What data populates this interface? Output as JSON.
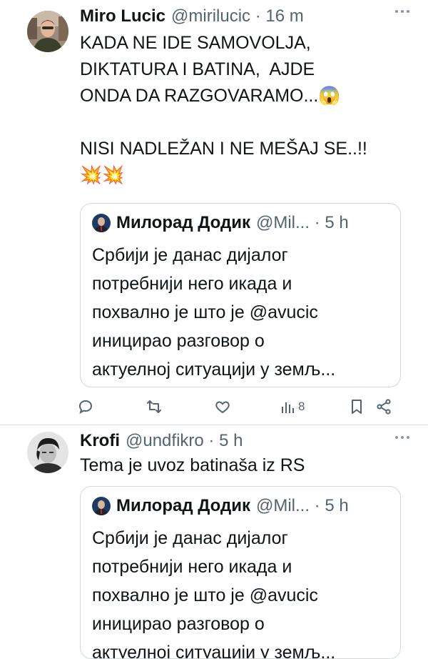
{
  "colors": {
    "text": "#0f1419",
    "secondary": "#536471",
    "border": "#cfd9de",
    "separator": "#d7dbdf"
  },
  "tweets": [
    {
      "author": "Miro Lucic",
      "handle": "@mirilucic · 16 m",
      "text": "KADA NE IDE SAMOVOLJA,\nDIKTATURA I BATINA,  AJDE\nONDA DA RAZGOVARAMO...😱\n\nNISI NADLEŽAN I NE MEŠAJ SE..!!\n💥💥",
      "quote": {
        "author": "Милорад Додик",
        "handle": "@Mil... · 5 h",
        "text": "Србији је данас дијалог\nпотребнији него икада и\nпохвално је што је @avucic\nиницирао разговор о\nактуелној ситуацији у земљ..."
      },
      "actions": {
        "reply_icon": "reply-icon",
        "retweet_icon": "retweet-icon",
        "like_icon": "like-icon",
        "views_icon": "views-icon",
        "views_count": "8",
        "bookmark_icon": "bookmark-icon",
        "share_icon": "share-icon"
      }
    },
    {
      "author": "Krofi",
      "handle": "@undfikro · 5 h",
      "text": "Tema je uvoz batinaša iz RS",
      "quote": {
        "author": "Милорад Додик",
        "handle": "@Mil... · 5 h",
        "text": "Србији је данас дијалог\nпотребнији него икада и\nпохвално је што је @avucic\nиницирао разговор о\nактуелној ситуацији у земљ..."
      }
    }
  ]
}
